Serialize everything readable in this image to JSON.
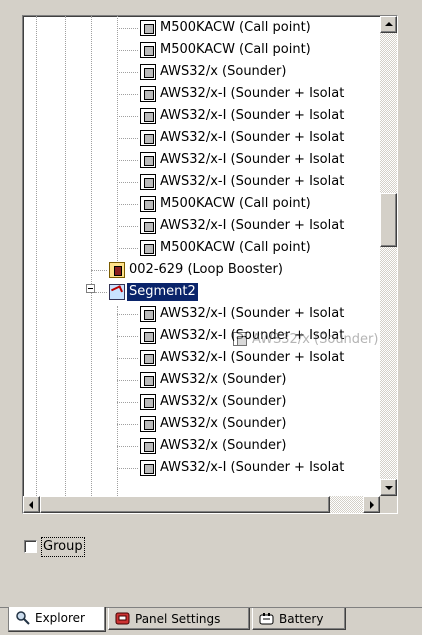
{
  "tree": {
    "rows": [
      {
        "label": "M500KACW (Call point)",
        "icon": "call-point-device-icon"
      },
      {
        "label": "M500KACW (Call point)",
        "icon": "call-point-device-icon"
      },
      {
        "label": "AWS32/x (Sounder)",
        "icon": "sounder-device-icon"
      },
      {
        "label": "AWS32/x-I (Sounder + Isolat",
        "icon": "sounder-isolator-device-icon"
      },
      {
        "label": "AWS32/x-I (Sounder + Isolat",
        "icon": "sounder-isolator-device-icon"
      },
      {
        "label": "AWS32/x-I (Sounder + Isolat",
        "icon": "sounder-isolator-device-icon"
      },
      {
        "label": "AWS32/x-I (Sounder + Isolat",
        "icon": "sounder-isolator-device-icon"
      },
      {
        "label": "AWS32/x-I (Sounder + Isolat",
        "icon": "sounder-isolator-device-icon"
      },
      {
        "label": "M500KACW (Call point)",
        "icon": "call-point-device-icon"
      },
      {
        "label": "AWS32/x-I (Sounder + Isolat",
        "icon": "sounder-isolator-device-icon"
      },
      {
        "label": "M500KACW (Call point)",
        "icon": "call-point-device-icon"
      },
      {
        "label": "002-629 (Loop Booster)",
        "icon": "loop-booster-icon"
      },
      {
        "label": "Segment2",
        "icon": "segment-icon",
        "selected": true
      },
      {
        "label": "AWS32/x-I (Sounder + Isolat",
        "icon": "sounder-isolator-device-icon"
      },
      {
        "label": "AWS32/x-I (Sounder + Isolat",
        "icon": "sounder-isolator-device-icon"
      },
      {
        "label": "AWS32/x-I (Sounder + Isolat",
        "icon": "sounder-isolator-device-icon"
      },
      {
        "label": "AWS32/x (Sounder)",
        "icon": "sounder-device-icon"
      },
      {
        "label": "AWS32/x (Sounder)",
        "icon": "sounder-device-icon"
      },
      {
        "label": "AWS32/x (Sounder)",
        "icon": "sounder-device-icon"
      },
      {
        "label": "AWS32/x (Sounder)",
        "icon": "sounder-device-icon"
      },
      {
        "label": "AWS32/x-I (Sounder + Isolat",
        "icon": "sounder-isolator-device-icon"
      }
    ],
    "drag_ghost_label": "AWS32/x (Sounder)"
  },
  "group_checkbox": {
    "label": "Group",
    "checked": false
  },
  "tabs": [
    {
      "label": "Explorer",
      "icon": "magnifier-icon",
      "active": true
    },
    {
      "label": "Panel Settings",
      "icon": "panel-icon",
      "active": false
    },
    {
      "label": "Battery",
      "icon": "battery-icon",
      "active": false
    }
  ],
  "colors": {
    "selection": "#0a246a",
    "window_bg": "#d4d0c8"
  }
}
